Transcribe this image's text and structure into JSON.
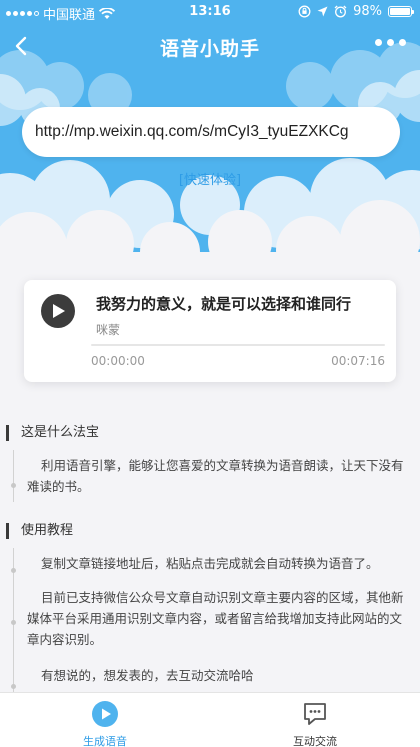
{
  "status_bar": {
    "carrier": "中国联通",
    "time": "13:16",
    "battery": "98%",
    "battery_level": 0.98
  },
  "nav": {
    "title": "语音小助手"
  },
  "search": {
    "value": "http://mp.weixin.qq.com/s/mCyI3_tyuEZXKCg",
    "quick_label": "[快速体验]"
  },
  "player": {
    "title": "我努力的意义，就是可以选择和谁同行",
    "author": "咪蒙",
    "current_time": "00:00:00",
    "total_time": "00:07:16",
    "progress": 0
  },
  "sections": [
    {
      "heading": "这是什么法宝",
      "paragraphs": [
        "利用语音引擎，能够让您喜爱的文章转换为语音朗读，让天下没有难读的书。"
      ]
    },
    {
      "heading": "使用教程",
      "paragraphs": [
        "复制文章链接地址后，粘贴点击完成就会自动转换为语音了。",
        "目前已支持微信公众号文章自动识别文章主要内容的区域，其他新媒体平台采用通用识别文章内容，或者留言给我增加支持此网站的文章内容识别。",
        "有想说的，想发表的，去互动交流哈哈"
      ]
    }
  ],
  "tabs": [
    {
      "label": "生成语音",
      "icon": "play-circle-icon",
      "active": true
    },
    {
      "label": "互动交流",
      "icon": "chat-bubble-icon",
      "active": false
    }
  ],
  "colors": {
    "accent": "#2e9ce6",
    "sky": "#4fb3ee",
    "background": "#f4f4f7"
  }
}
